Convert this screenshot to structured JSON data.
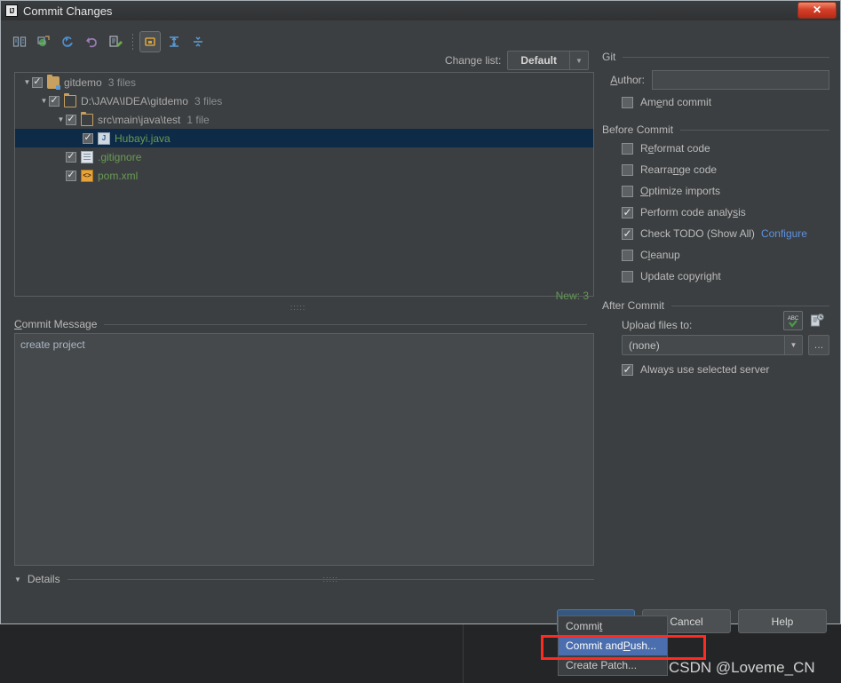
{
  "window": {
    "title": "Commit Changes",
    "app_icon": "IJ",
    "close_label": "✕"
  },
  "toolbar": {
    "items": [
      {
        "name": "show-diff-icon",
        "glyph": "⌲"
      },
      {
        "name": "show-diff-new-window-icon",
        "glyph": "◳"
      },
      {
        "name": "refresh-icon",
        "glyph": "↻"
      },
      {
        "name": "revert-icon",
        "glyph": "↶"
      },
      {
        "name": "edit-source-icon",
        "glyph": "✎"
      },
      {
        "name": "group-by-directory-icon",
        "glyph": "▣"
      },
      {
        "name": "expand-all-icon",
        "glyph": "↕"
      },
      {
        "name": "collapse-all-icon",
        "glyph": "⤓"
      }
    ]
  },
  "changelist": {
    "label": "Change list:",
    "value": "Default",
    "arrow": "▼"
  },
  "tree": {
    "rows": [
      {
        "indent": 0,
        "twisty": "▼",
        "checked": true,
        "icon": "folder-module",
        "label": "gitdemo",
        "label_color": "grey",
        "count": "3 files"
      },
      {
        "indent": 1,
        "twisty": "▼",
        "checked": true,
        "icon": "folder-open",
        "label": "D:\\JAVA\\IDEA\\gitdemo",
        "label_color": "grey",
        "count": "3 files"
      },
      {
        "indent": 2,
        "twisty": "▼",
        "checked": true,
        "icon": "folder-open",
        "label": "src\\main\\java\\test",
        "label_color": "grey",
        "count": "1 file"
      },
      {
        "indent": 3,
        "twisty": "",
        "checked": true,
        "icon": "java",
        "label": "Hubayi.java",
        "label_color": "green",
        "count": "",
        "selected": true
      },
      {
        "indent": 2,
        "twisty": "",
        "checked": true,
        "icon": "text",
        "label": ".gitignore",
        "label_color": "green",
        "count": ""
      },
      {
        "indent": 2,
        "twisty": "",
        "checked": true,
        "icon": "xml",
        "label": "pom.xml",
        "label_color": "green",
        "count": ""
      }
    ],
    "new_count": "New: 3",
    "splitter_dots": ":::::"
  },
  "commit_message": {
    "label_prefix": "C",
    "label_rest": "ommit Message",
    "value": "create project",
    "spellcheck_icon_text": "ABC",
    "spellcheck_check": "✔",
    "history_icon": "☷"
  },
  "details": {
    "arrow": "▼",
    "label": "Details",
    "dots": ":::::"
  },
  "git_section": {
    "title": "Git",
    "author_label_prefix": "A",
    "author_label_rest": "uthor:",
    "author_value": "",
    "amend": {
      "label_prefix": "Am",
      "label_mnemonic": "e",
      "label_rest": "nd commit",
      "checked": false
    }
  },
  "before_commit": {
    "title": "Before Commit",
    "items": [
      {
        "name": "reformat-code",
        "prefix": "R",
        "mnemonic": "e",
        "rest": "format code",
        "checked": false
      },
      {
        "name": "rearrange-code",
        "prefix": "Rearra",
        "mnemonic": "n",
        "rest": "ge code",
        "checked": false
      },
      {
        "name": "optimize-imports",
        "prefix": "",
        "mnemonic": "O",
        "rest": "ptimize imports",
        "checked": false
      },
      {
        "name": "perform-code-analysis",
        "prefix": "Perform code analy",
        "mnemonic": "s",
        "rest": "is",
        "checked": true
      },
      {
        "name": "check-todo",
        "prefix": "Check TODO (Show All)",
        "mnemonic": "",
        "rest": "",
        "checked": true,
        "link": "Configure"
      },
      {
        "name": "cleanup",
        "prefix": "C",
        "mnemonic": "l",
        "rest": "eanup",
        "checked": false
      },
      {
        "name": "update-copyright",
        "prefix": "Update copyright",
        "mnemonic": "",
        "rest": "",
        "checked": false
      }
    ]
  },
  "after_commit": {
    "title": "After Commit",
    "upload_label": "Upload files to:",
    "upload_value": "(none)",
    "upload_arrow": "▼",
    "browse_label": "…",
    "always_use_server": {
      "label": "Always use selected server",
      "checked": true
    }
  },
  "buttons": {
    "commit": "Commit",
    "commit_caret": "▾",
    "cancel": "Cancel",
    "help": "Help"
  },
  "menu": {
    "items": [
      {
        "name": "menu-item-commit",
        "prefix": "Commi",
        "mnemonic": "t",
        "rest": "",
        "highlighted": false
      },
      {
        "name": "menu-item-commit-and-push",
        "prefix": "Commit and ",
        "mnemonic": "P",
        "rest": "ush...",
        "highlighted": true
      },
      {
        "name": "menu-item-create-patch",
        "prefix": "Create Patch...",
        "mnemonic": "",
        "rest": "",
        "highlighted": false
      }
    ]
  },
  "watermark": "CSDN @Loveme_CN",
  "colors": {
    "accent": "#4b6eaf",
    "primary_button": "#365880",
    "new_file": "#629755",
    "link": "#5c91e0",
    "annotation": "#ff2a22",
    "selection": "#0d2b47"
  }
}
